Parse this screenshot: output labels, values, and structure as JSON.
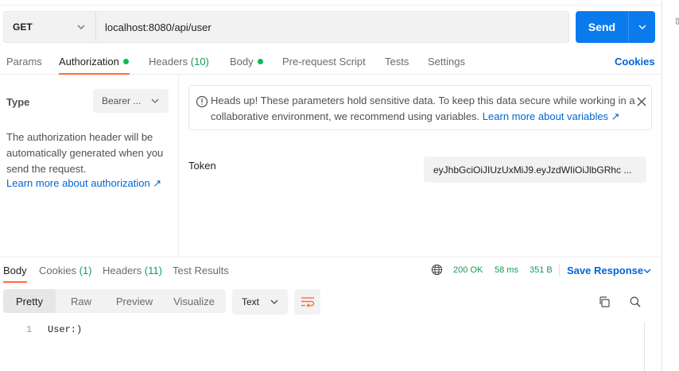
{
  "request": {
    "method": "GET",
    "url": "localhost:8080/api/user",
    "send_label": "Send"
  },
  "request_tabs": {
    "params": "Params",
    "authorization": "Authorization",
    "headers_label": "Headers",
    "headers_count": "(10)",
    "body": "Body",
    "pre_request": "Pre-request Script",
    "tests": "Tests",
    "settings": "Settings",
    "cookies": "Cookies"
  },
  "auth": {
    "type_label": "Type",
    "type_value": "Bearer ...",
    "description": "The authorization header will be automatically generated when you send the request.",
    "learn_more": "Learn more about authorization ↗",
    "warning_text": "Heads up! These parameters hold sensitive data. To keep this data secure while working in a collaborative environment, we recommend using variables.",
    "warning_link": "Learn more about variables ↗",
    "token_label": "Token",
    "token_value": "eyJhbGciOiJIUzUxMiJ9.eyJzdWIiOiJlbGRhc ..."
  },
  "response_tabs": {
    "body": "Body",
    "cookies_label": "Cookies",
    "cookies_count": "(1)",
    "headers_label": "Headers",
    "headers_count": "(11)",
    "test_results": "Test Results"
  },
  "response_meta": {
    "status": "200 OK",
    "time": "58 ms",
    "size": "351 B",
    "save_response": "Save Response"
  },
  "response_view": {
    "modes": [
      "Pretty",
      "Raw",
      "Preview",
      "Visualize"
    ],
    "format": "Text"
  },
  "response_body": {
    "line_number": "1",
    "content": "User:)"
  },
  "colors": {
    "accent": "#ff6c37",
    "send": "#097bed",
    "link": "#0265d2",
    "success": "#0f9d58"
  }
}
